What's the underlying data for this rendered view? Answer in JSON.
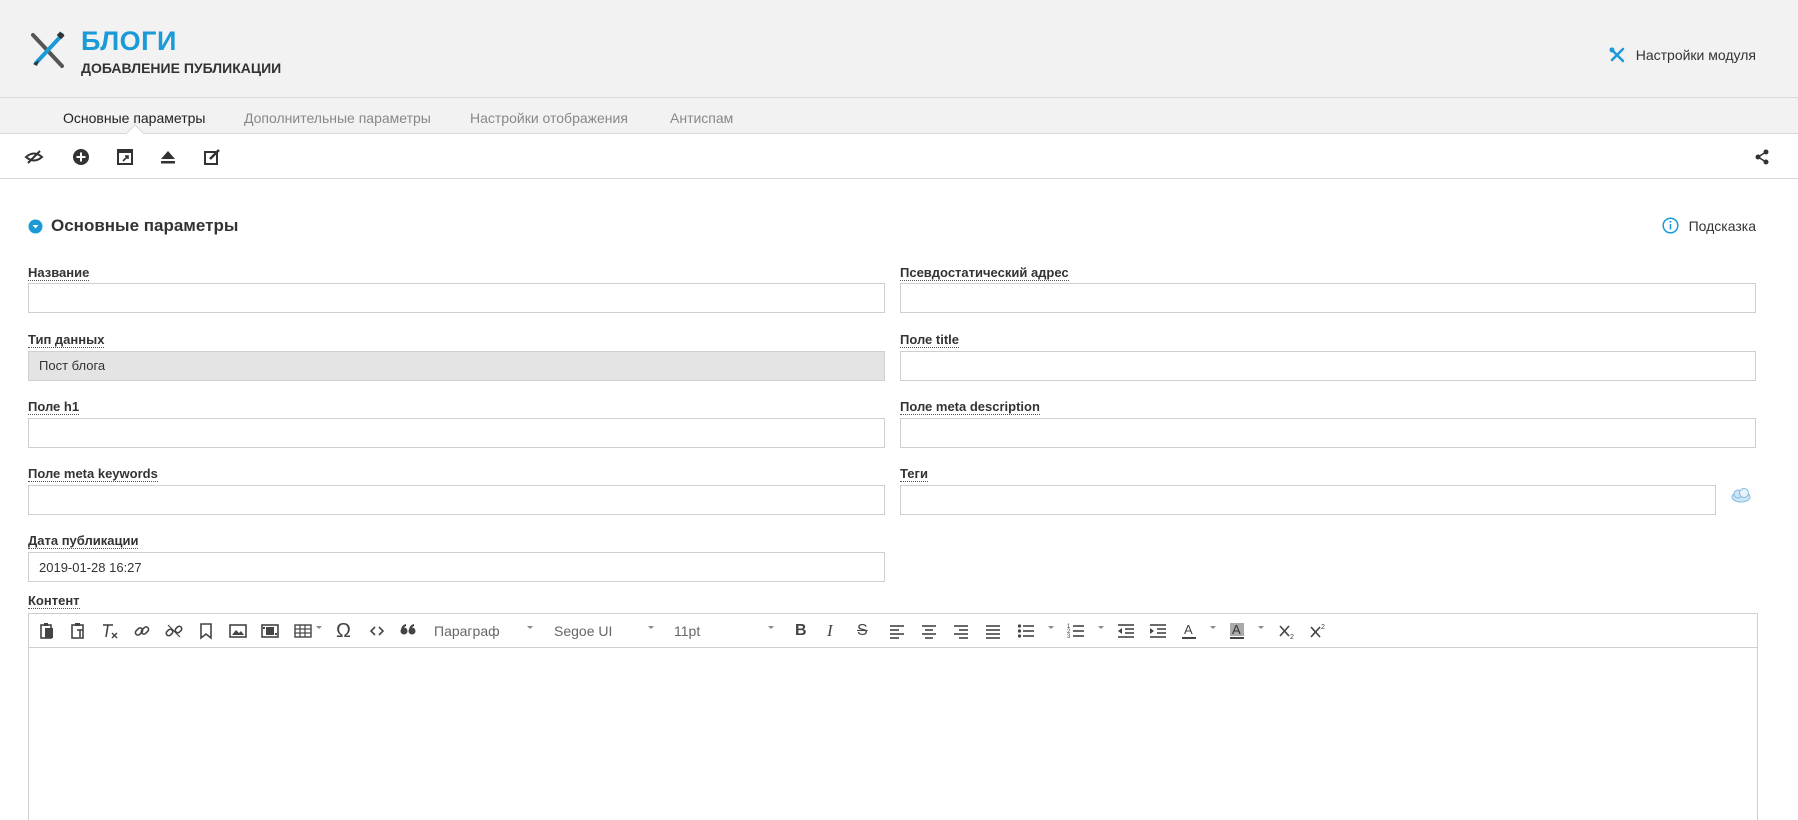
{
  "header": {
    "title": "БЛОГИ",
    "subtitle": "ДОБАВЛЕНИЕ ПУБЛИКАЦИИ",
    "module_settings": "Настройки модуля",
    "logo_icon": "blog-logo-icon",
    "settings_icon": "tools-icon"
  },
  "tabs": [
    {
      "label": "Основные параметры",
      "active": true
    },
    {
      "label": "Дополнительные параметры",
      "active": false
    },
    {
      "label": "Настройки отображения",
      "active": false
    },
    {
      "label": "Антиспам",
      "active": false
    }
  ],
  "toolbar": {
    "icons": [
      "hide-icon",
      "add-circle-icon",
      "open-window-icon",
      "eject-icon",
      "edit-icon",
      "share-icon"
    ]
  },
  "section": {
    "title": "Основные параметры",
    "hint": "Подсказка"
  },
  "fields": {
    "name": {
      "label": "Название",
      "value": ""
    },
    "pseudo_address": {
      "label": "Псевдостатический адрес",
      "value": ""
    },
    "data_type": {
      "label": "Тип данных",
      "value": "Пост блога"
    },
    "title_field": {
      "label": "Поле title",
      "value": ""
    },
    "h1": {
      "label": "Поле h1",
      "value": ""
    },
    "meta_description": {
      "label": "Поле meta description",
      "value": ""
    },
    "meta_keywords": {
      "label": "Поле meta keywords",
      "value": ""
    },
    "tags": {
      "label": "Теги",
      "value": ""
    },
    "pub_date": {
      "label": "Дата публикации",
      "value": "2019-01-28 16:27"
    },
    "content": {
      "label": "Контент"
    }
  },
  "editor": {
    "format": "Параграф",
    "font": "Segoe UI",
    "size": "11pt"
  },
  "colors": {
    "accent": "#1a9bd7",
    "header_bg": "#f2f2f2",
    "disabled_bg": "#e4e4e4"
  }
}
